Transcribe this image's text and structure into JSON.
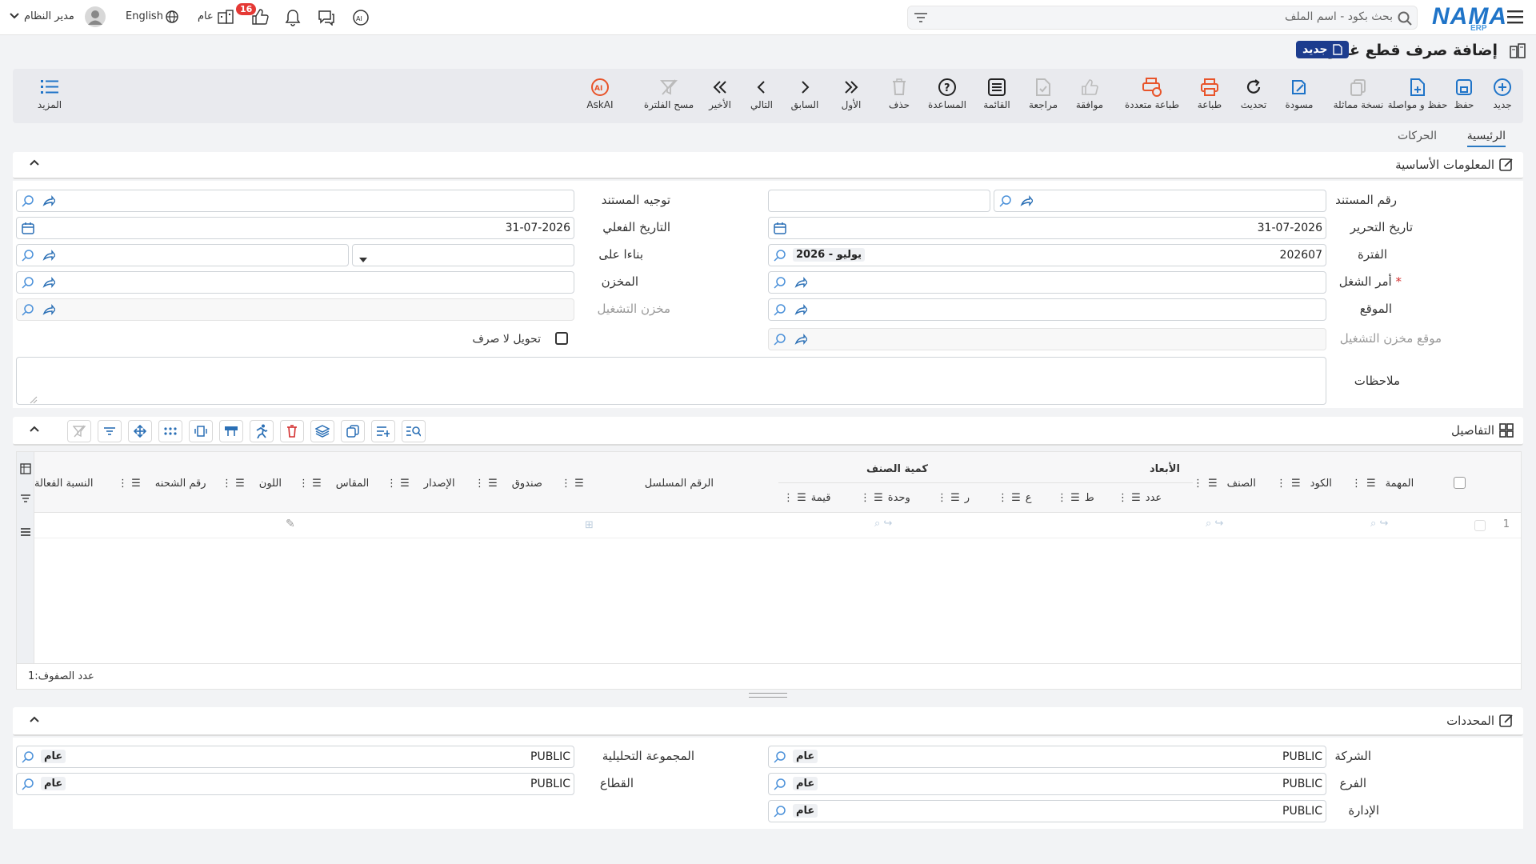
{
  "topbar": {
    "search_placeholder": "بحث بكود - اسم الملف",
    "logo": "NAMA",
    "logo_sub": "ERP",
    "user_name": "مدير النظام",
    "language": "English",
    "scope": "عام",
    "notif_count": "16"
  },
  "title": {
    "text": "إضافة صرف قطع غيار",
    "badge": "جديد"
  },
  "toolbar": {
    "new": "جديد",
    "save": "حفظ",
    "save_continue": "حفظ و مواصلة",
    "copy": "نسخة مماثلة",
    "draft": "مسودة",
    "refresh": "تحديث",
    "print": "طباعة",
    "multi_print": "طباعة متعددة",
    "approve": "موافقة",
    "review": "مراجعة",
    "list": "القائمة",
    "help": "المساعدة",
    "delete": "حذف",
    "first": "الأول",
    "prev": "السابق",
    "next": "التالي",
    "last": "الأخير",
    "clear_filter": "مسح الفلترة",
    "askai": "AskAI",
    "more": "المزيد"
  },
  "tabs": {
    "main": "الرئيسية",
    "movements": "الحركات"
  },
  "basic": {
    "title": "المعلومات الأساسية",
    "doc_no": "رقم المستند",
    "doc_direction": "توجيه المستند",
    "edit_date": "تاريخ التحرير",
    "edit_date_val": "31-07-2026",
    "actual_date": "التاريخ الفعلي",
    "actual_date_val": "31-07-2026",
    "period": "الفترة",
    "period_code": "202607",
    "period_name": "2026 - يوليو",
    "based_on": "بناءا على",
    "work_order": "أمر الشغل",
    "warehouse": "المخزن",
    "location": "الموقع",
    "op_warehouse": "مخزن التشغيل",
    "op_location": "موقع مخزن التشغيل",
    "transfer_no_issue": "تحويل لا صرف",
    "notes": "ملاحظات"
  },
  "details": {
    "title": "التفاصيل",
    "columns": {
      "task": "المهمة",
      "code": "الكود",
      "item": "الصنف",
      "dims": "الأبعاد",
      "count": "عدد",
      "l": "ط",
      "w": "ع",
      "h": "ر",
      "item_qty": "كمية الصنف",
      "unit": "وحدة",
      "value": "قيمة",
      "serial": "الرقم المسلسل",
      "box": "صندوق",
      "release": "الإصدار",
      "size": "المقاس",
      "color": "اللون",
      "batch": "رقم الشحنه",
      "active_ratio": "النسبة الفعالة"
    },
    "row_no": "1",
    "row_count": "عدد الصفوف:1"
  },
  "dims": {
    "title": "المحددات",
    "company": "الشركة",
    "branch": "الفرع",
    "department": "الإدارة",
    "analytic": "المجموعة التحليلية",
    "sector": "القطاع",
    "public": "PUBLIC",
    "general": "عام"
  },
  "colors": {
    "accent": "#1f74c8",
    "badge": "#1c3c8e",
    "orange": "#e8542a",
    "notif": "#e53935"
  }
}
